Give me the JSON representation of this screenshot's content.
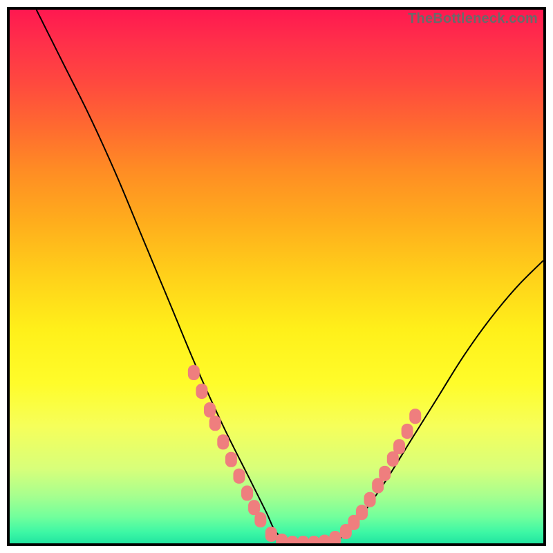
{
  "watermark": "TheBottleneck.com",
  "chart_data": {
    "type": "line",
    "title": "",
    "xlabel": "",
    "ylabel": "",
    "xlim": [
      0,
      100
    ],
    "ylim": [
      0,
      100
    ],
    "grid": false,
    "legend": false,
    "background_gradient": {
      "top_color": "#ff1850",
      "bottom_color": "#22e5a0",
      "description": "vertical red-orange-yellow-green gradient"
    },
    "series": [
      {
        "name": "bottleneck-curve",
        "color": "#000000",
        "x": [
          5,
          10,
          15,
          20,
          25,
          30,
          35,
          40,
          45,
          48,
          50,
          53,
          56,
          60,
          62,
          65,
          70,
          75,
          80,
          85,
          90,
          95,
          100
        ],
        "y": [
          100,
          90,
          80,
          69,
          57,
          45,
          33,
          22,
          12,
          6,
          2,
          0,
          0,
          0,
          1,
          4,
          11,
          19,
          27,
          35,
          42,
          48,
          53
        ]
      }
    ],
    "markers": [
      {
        "x": 34.5,
        "y": 32.0
      },
      {
        "x": 36.0,
        "y": 28.5
      },
      {
        "x": 37.5,
        "y": 25.0
      },
      {
        "x": 38.5,
        "y": 22.5
      },
      {
        "x": 40.0,
        "y": 19.0
      },
      {
        "x": 41.5,
        "y": 15.7
      },
      {
        "x": 43.0,
        "y": 12.6
      },
      {
        "x": 44.5,
        "y": 9.4
      },
      {
        "x": 45.8,
        "y": 6.7
      },
      {
        "x": 47.0,
        "y": 4.4
      },
      {
        "x": 49.0,
        "y": 1.7
      },
      {
        "x": 51.0,
        "y": 0.4
      },
      {
        "x": 53.0,
        "y": 0.0
      },
      {
        "x": 55.0,
        "y": 0.0
      },
      {
        "x": 57.0,
        "y": 0.0
      },
      {
        "x": 59.0,
        "y": 0.2
      },
      {
        "x": 61.0,
        "y": 0.9
      },
      {
        "x": 63.0,
        "y": 2.2
      },
      {
        "x": 64.5,
        "y": 3.9
      },
      {
        "x": 66.0,
        "y": 5.8
      },
      {
        "x": 67.5,
        "y": 8.2
      },
      {
        "x": 69.0,
        "y": 10.8
      },
      {
        "x": 70.3,
        "y": 13.1
      },
      {
        "x": 71.8,
        "y": 15.8
      },
      {
        "x": 73.0,
        "y": 18.1
      },
      {
        "x": 74.5,
        "y": 21.0
      },
      {
        "x": 76.0,
        "y": 23.8
      }
    ],
    "marker_style": {
      "color": "#ef7e7e",
      "shape": "rounded-rect",
      "approx_size_px": 18
    }
  }
}
